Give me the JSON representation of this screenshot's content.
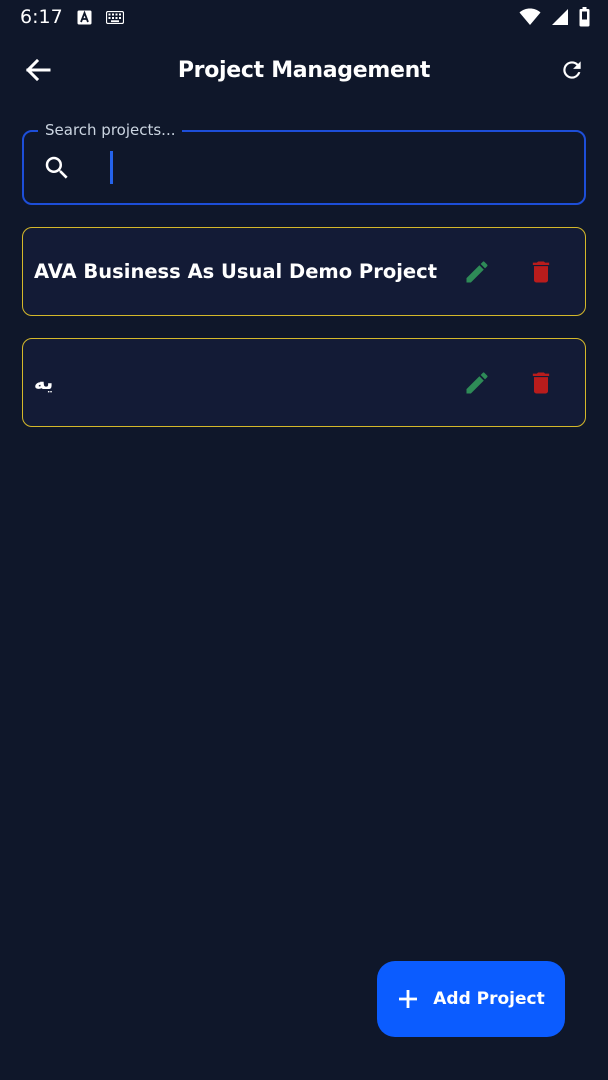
{
  "status_bar": {
    "time": "6:17",
    "icons": [
      "text-a-icon",
      "keyboard-icon",
      "wifi-icon",
      "signal-icon",
      "battery-icon"
    ]
  },
  "app_bar": {
    "title": "Project Management",
    "back_icon": "arrow-back-icon",
    "refresh_icon": "refresh-icon"
  },
  "search": {
    "label": "Search projects...",
    "value": "",
    "icon": "search-icon"
  },
  "projects": [
    {
      "name": "AVA Business As Usual Demo Project",
      "edit_icon": "pencil-icon",
      "delete_icon": "trash-icon"
    },
    {
      "name": "یه",
      "edit_icon": "pencil-icon",
      "delete_icon": "trash-icon"
    }
  ],
  "fab": {
    "label": "Add Project",
    "icon": "plus-icon"
  },
  "colors": {
    "background": "#0f172a",
    "card_background": "#131b36",
    "card_border": "#d4b82a",
    "accent_blue": "#0b5cff",
    "search_border": "#1d4ed8",
    "edit_green": "#2e8b57",
    "delete_red": "#b91c1c"
  }
}
